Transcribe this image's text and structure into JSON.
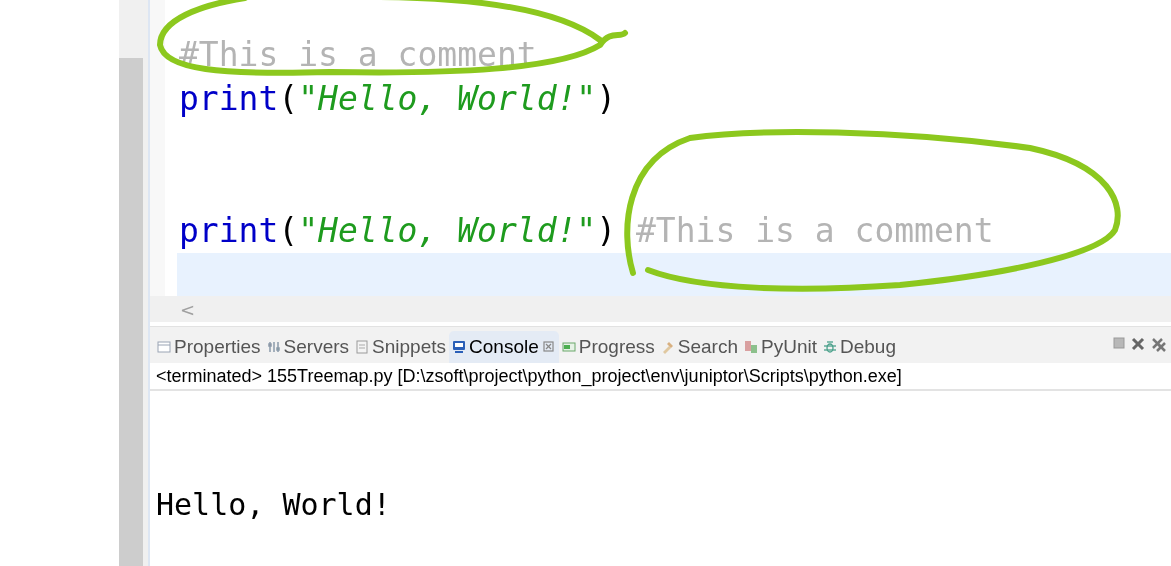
{
  "editor": {
    "lines": [
      {
        "current": false,
        "tokens": [
          {
            "kind": "comment",
            "text": "#This is a comment"
          }
        ]
      },
      {
        "current": false,
        "tokens": [
          {
            "kind": "keyword",
            "text": "print"
          },
          {
            "kind": "paren",
            "text": "("
          },
          {
            "kind": "string",
            "text": "\"Hello, World!\""
          },
          {
            "kind": "paren",
            "text": ")"
          }
        ]
      },
      {
        "current": false
      },
      {
        "current": false
      },
      {
        "current": false,
        "tokens": [
          {
            "kind": "keyword",
            "text": "print"
          },
          {
            "kind": "paren",
            "text": "("
          },
          {
            "kind": "string",
            "text": "\"Hello, World!\""
          },
          {
            "kind": "paren",
            "text": ")"
          },
          {
            "kind": "comment",
            "text": " #This is a comment"
          }
        ]
      },
      {
        "current": true
      }
    ],
    "scroll_left": "<"
  },
  "tabs": [
    {
      "label": "Properties",
      "selected": false
    },
    {
      "label": "Servers",
      "selected": false
    },
    {
      "label": "Snippets",
      "selected": false
    },
    {
      "label": "Console",
      "selected": true
    },
    {
      "label": "Progress",
      "selected": false
    },
    {
      "label": "Search",
      "selected": false
    },
    {
      "label": "PyUnit",
      "selected": false
    },
    {
      "label": "Debug",
      "selected": false
    }
  ],
  "console": {
    "header": "<terminated> 155Treemap.py [D:\\zsoft\\project\\python_project\\env\\juniptor\\Scripts\\python.exe]",
    "output": [
      "Hello, World!"
    ]
  }
}
